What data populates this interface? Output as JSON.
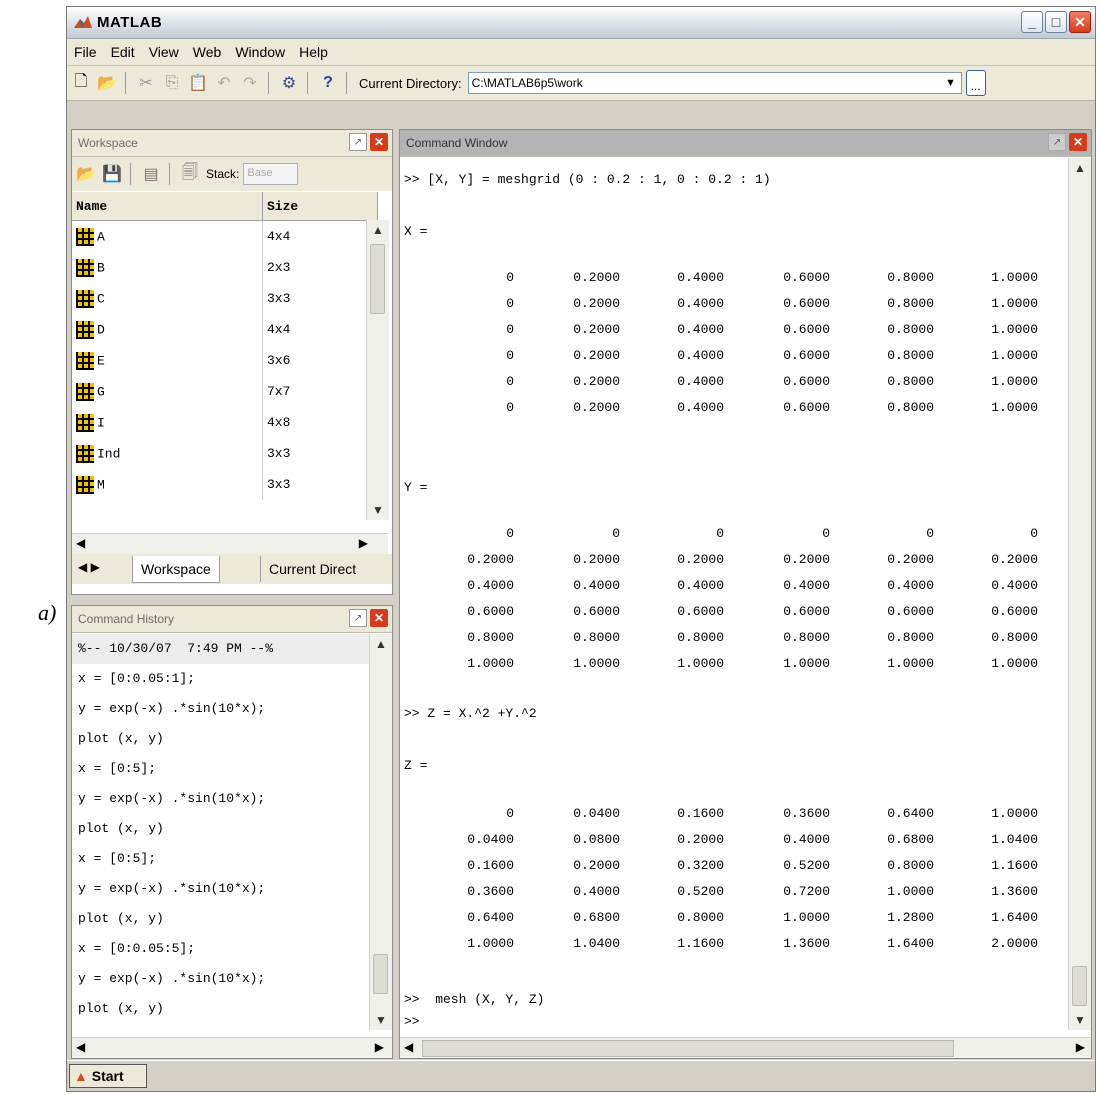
{
  "caption": "a)",
  "window": {
    "title": "MATLAB"
  },
  "menu": [
    "File",
    "Edit",
    "View",
    "Web",
    "Window",
    "Help"
  ],
  "toolbar": {
    "current_dir_label": "Current Directory:",
    "current_dir_value": "C:\\MATLAB6p5\\work",
    "browse": "..."
  },
  "workspace": {
    "title": "Workspace",
    "stack_label": "Stack:",
    "stack_value": "Base",
    "columns": [
      "Name",
      "Size"
    ],
    "rows": [
      [
        "A",
        "4x4"
      ],
      [
        "B",
        "2x3"
      ],
      [
        "C",
        "3x3"
      ],
      [
        "D",
        "4x4"
      ],
      [
        "E",
        "3x6"
      ],
      [
        "G",
        "7x7"
      ],
      [
        "I",
        "4x8"
      ],
      [
        "Ind",
        "3x3"
      ],
      [
        "M",
        "3x3"
      ]
    ],
    "tabs": [
      "Workspace",
      "Current Direct"
    ]
  },
  "history": {
    "title": "Command History",
    "lines": [
      "%-- 10/30/07  7:49 PM --%",
      "x = [0:0.05:1];",
      "y = exp(-x) .*sin(10*x);",
      "plot (x, y)",
      "x = [0:5];",
      "y = exp(-x) .*sin(10*x);",
      "plot (x, y)",
      "x = [0:5];",
      "y = exp(-x) .*sin(10*x);",
      "plot (x, y)",
      "x = [0:0.05:5];",
      "y = exp(-x) .*sin(10*x);",
      "plot (x, y)"
    ]
  },
  "command": {
    "title": "Command Window",
    "cmd1": ">> [X, Y] = meshgrid (0 : 0.2 : 1, 0 : 0.2 : 1)",
    "x_label": "X =",
    "x_rows": [
      [
        "0",
        "0.2000",
        "0.4000",
        "0.6000",
        "0.8000",
        "1.0000"
      ],
      [
        "0",
        "0.2000",
        "0.4000",
        "0.6000",
        "0.8000",
        "1.0000"
      ],
      [
        "0",
        "0.2000",
        "0.4000",
        "0.6000",
        "0.8000",
        "1.0000"
      ],
      [
        "0",
        "0.2000",
        "0.4000",
        "0.6000",
        "0.8000",
        "1.0000"
      ],
      [
        "0",
        "0.2000",
        "0.4000",
        "0.6000",
        "0.8000",
        "1.0000"
      ],
      [
        "0",
        "0.2000",
        "0.4000",
        "0.6000",
        "0.8000",
        "1.0000"
      ]
    ],
    "y_label": "Y =",
    "y_rows": [
      [
        "0",
        "0",
        "0",
        "0",
        "0",
        "0"
      ],
      [
        "0.2000",
        "0.2000",
        "0.2000",
        "0.2000",
        "0.2000",
        "0.2000"
      ],
      [
        "0.4000",
        "0.4000",
        "0.4000",
        "0.4000",
        "0.4000",
        "0.4000"
      ],
      [
        "0.6000",
        "0.6000",
        "0.6000",
        "0.6000",
        "0.6000",
        "0.6000"
      ],
      [
        "0.8000",
        "0.8000",
        "0.8000",
        "0.8000",
        "0.8000",
        "0.8000"
      ],
      [
        "1.0000",
        "1.0000",
        "1.0000",
        "1.0000",
        "1.0000",
        "1.0000"
      ]
    ],
    "cmd2": ">> Z = X.^2 +Y.^2",
    "z_label": "Z =",
    "z_rows": [
      [
        "0",
        "0.0400",
        "0.1600",
        "0.3600",
        "0.6400",
        "1.0000"
      ],
      [
        "0.0400",
        "0.0800",
        "0.2000",
        "0.4000",
        "0.6800",
        "1.0400"
      ],
      [
        "0.1600",
        "0.2000",
        "0.3200",
        "0.5200",
        "0.8000",
        "1.1600"
      ],
      [
        "0.3600",
        "0.4000",
        "0.5200",
        "0.7200",
        "1.0000",
        "1.3600"
      ],
      [
        "0.6400",
        "0.6800",
        "0.8000",
        "1.0000",
        "1.2800",
        "1.6400"
      ],
      [
        "1.0000",
        "1.0400",
        "1.1600",
        "1.3600",
        "1.6400",
        "2.0000"
      ]
    ],
    "cmd3": ">>  mesh (X, Y, Z)",
    "prompt": ">>"
  },
  "start": {
    "label": "Start"
  }
}
